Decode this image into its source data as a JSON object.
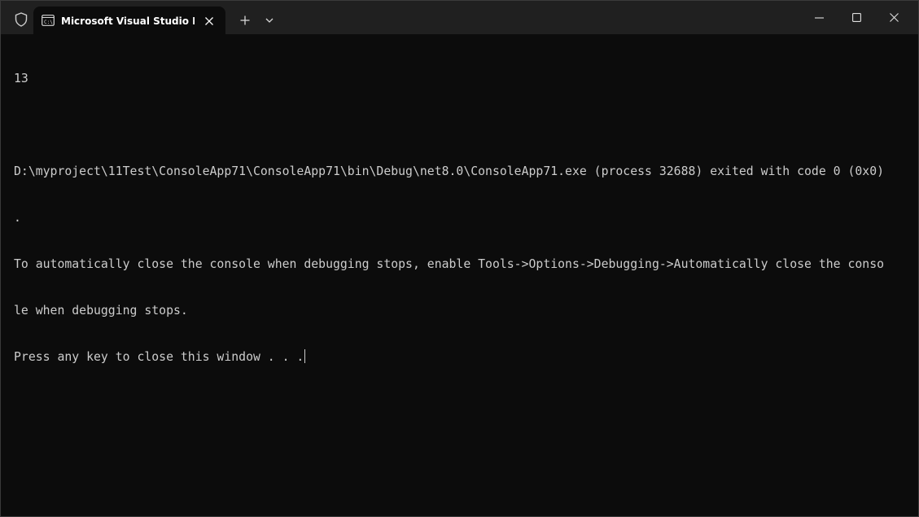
{
  "titlebar": {
    "tab_title": "Microsoft Visual Studio Debug Console",
    "icons": {
      "shield": "shield-icon",
      "tab": "console-icon",
      "close_tab": "close-icon",
      "new_tab": "plus-icon",
      "dropdown": "chevron-down-icon",
      "minimize": "minimize-icon",
      "maximize": "maximize-icon",
      "close_window": "close-icon"
    }
  },
  "console": {
    "lines": [
      "13",
      "",
      "D:\\myproject\\11Test\\ConsoleApp71\\ConsoleApp71\\bin\\Debug\\net8.0\\ConsoleApp71.exe (process 32688) exited with code 0 (0x0)",
      ".",
      "To automatically close the console when debugging stops, enable Tools->Options->Debugging->Automatically close the conso",
      "le when debugging stops.",
      "Press any key to close this window . . ."
    ]
  },
  "colors": {
    "background": "#0c0c0c",
    "titlebar": "#202020",
    "text": "#cccccc",
    "tab_title": "#ffffff"
  }
}
